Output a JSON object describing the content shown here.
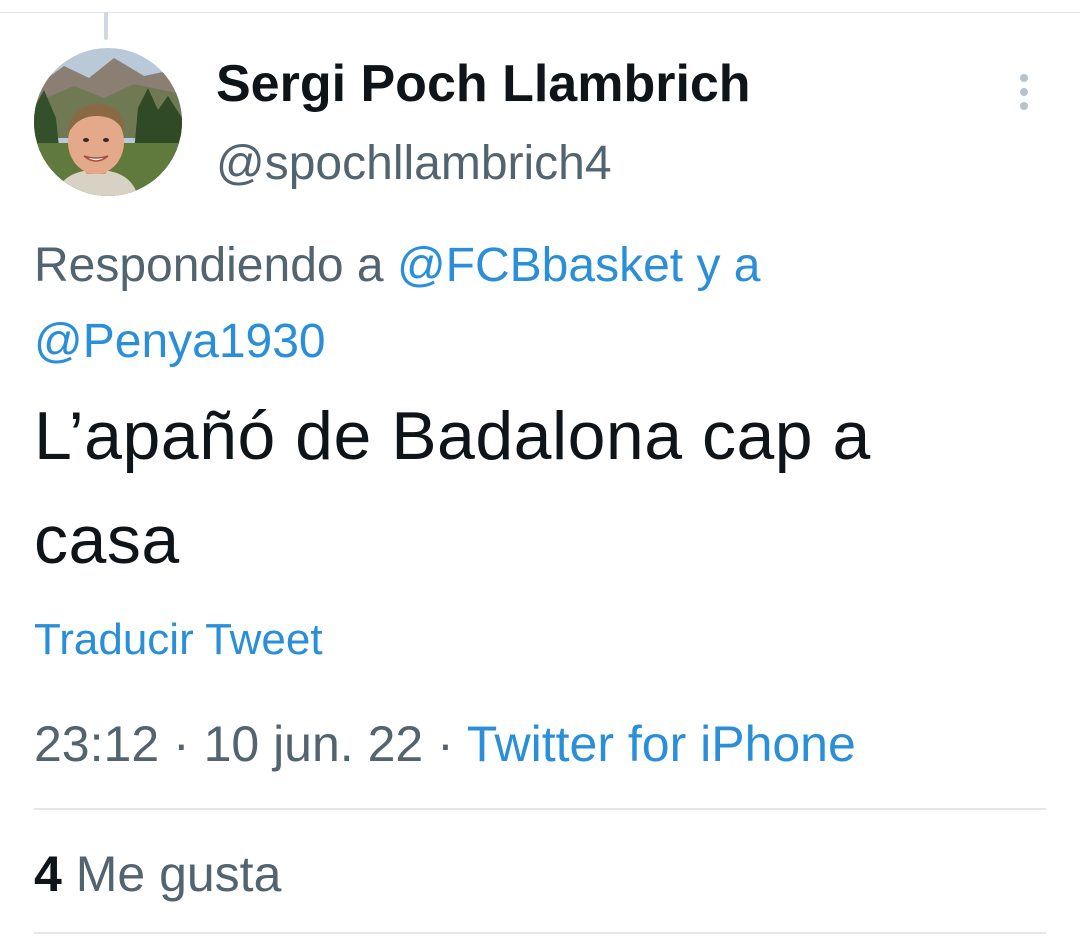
{
  "tweet": {
    "author": {
      "display_name": "Sergi Poch Llambrich",
      "handle": "@spochllambrich4",
      "avatar": "profile-photo"
    },
    "more_icon": "more-vertical-icon",
    "reply_context": {
      "prefix": "Respondiendo a ",
      "mention_1": "@FCBbasket",
      "connector": " y a",
      "mention_2": "@Penya1930"
    },
    "text": "L’apañó de Badalona cap a casa",
    "translate_label": "Traducir Tweet",
    "time": "23:12",
    "date": "10 jun. 22",
    "separator": " · ",
    "source": "Twitter for iPhone",
    "likes": {
      "count": "4",
      "label": "Me gusta"
    }
  },
  "colors": {
    "text_primary": "#0f1419",
    "text_secondary": "#536471",
    "link": "#2a8fd8",
    "divider": "#e3e7ea"
  }
}
